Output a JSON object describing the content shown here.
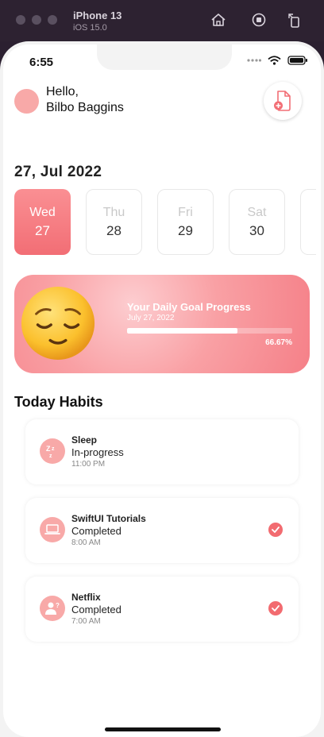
{
  "simulator": {
    "device_name": "iPhone 13",
    "os_version": "iOS 15.0"
  },
  "status_bar": {
    "time": "6:55"
  },
  "header": {
    "greeting": "Hello,",
    "user_name": "Bilbo Baggins"
  },
  "date_title": "27, Jul 2022",
  "week_days": [
    {
      "name": "Wed",
      "number": "27",
      "selected": true
    },
    {
      "name": "Thu",
      "number": "28",
      "selected": false
    },
    {
      "name": "Fri",
      "number": "29",
      "selected": false
    },
    {
      "name": "Sat",
      "number": "30",
      "selected": false
    }
  ],
  "goal": {
    "title": "Your Daily Goal Progress",
    "date": "July 27, 2022",
    "progress_fraction": 0.6667,
    "percent_label": "66.67%"
  },
  "habits_title": "Today Habits",
  "habits": [
    {
      "name": "Sleep",
      "status": "In-progress",
      "time": "11:00 PM",
      "icon": "sleep-zzz-icon",
      "completed": false
    },
    {
      "name": "SwiftUI Tutorials",
      "status": "Completed",
      "time": "8:00 AM",
      "icon": "laptop-icon",
      "completed": true
    },
    {
      "name": "Netflix",
      "status": "Completed",
      "time": "7:00 AM",
      "icon": "person-question-icon",
      "completed": true
    }
  ],
  "colors": {
    "accent": "#f26e75",
    "accent_light": "#f8a9a8",
    "simulator_bar": "#2d2231"
  }
}
